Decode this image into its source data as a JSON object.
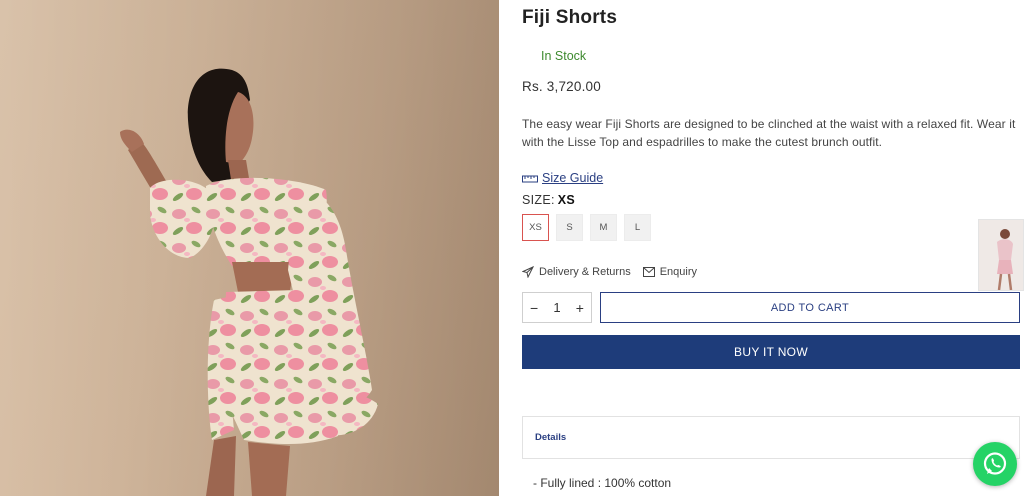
{
  "product": {
    "title": "Fiji Shorts",
    "stock": "In Stock",
    "price": "Rs. 3,720.00",
    "description": "The easy wear Fiji Shorts are designed to be clinched at the waist with a relaxed fit. Wear it with the Lisse Top and espadrilles to make the cutest brunch outfit."
  },
  "size_guide": {
    "label": "Size Guide",
    "icon": "ruler-icon"
  },
  "size": {
    "label": "SIZE:",
    "selected": "XS",
    "options": [
      "XS",
      "S",
      "M",
      "L"
    ]
  },
  "links": {
    "delivery": {
      "label": "Delivery & Returns",
      "icon": "paper-plane-icon"
    },
    "enquiry": {
      "label": "Enquiry",
      "icon": "envelope-icon"
    }
  },
  "quantity": {
    "minus": "−",
    "value": "1",
    "plus": "+"
  },
  "buttons": {
    "add_to_cart": "ADD TO CART",
    "buy_now": "BUY IT NOW"
  },
  "details": {
    "heading": "Details",
    "fabric": "- Fully lined : 100% cotton"
  },
  "colors": {
    "accent": "#1e3c7a",
    "stock_green": "#3e8a2f",
    "selected_size_border": "#d9534f",
    "whatsapp": "#25d366"
  }
}
